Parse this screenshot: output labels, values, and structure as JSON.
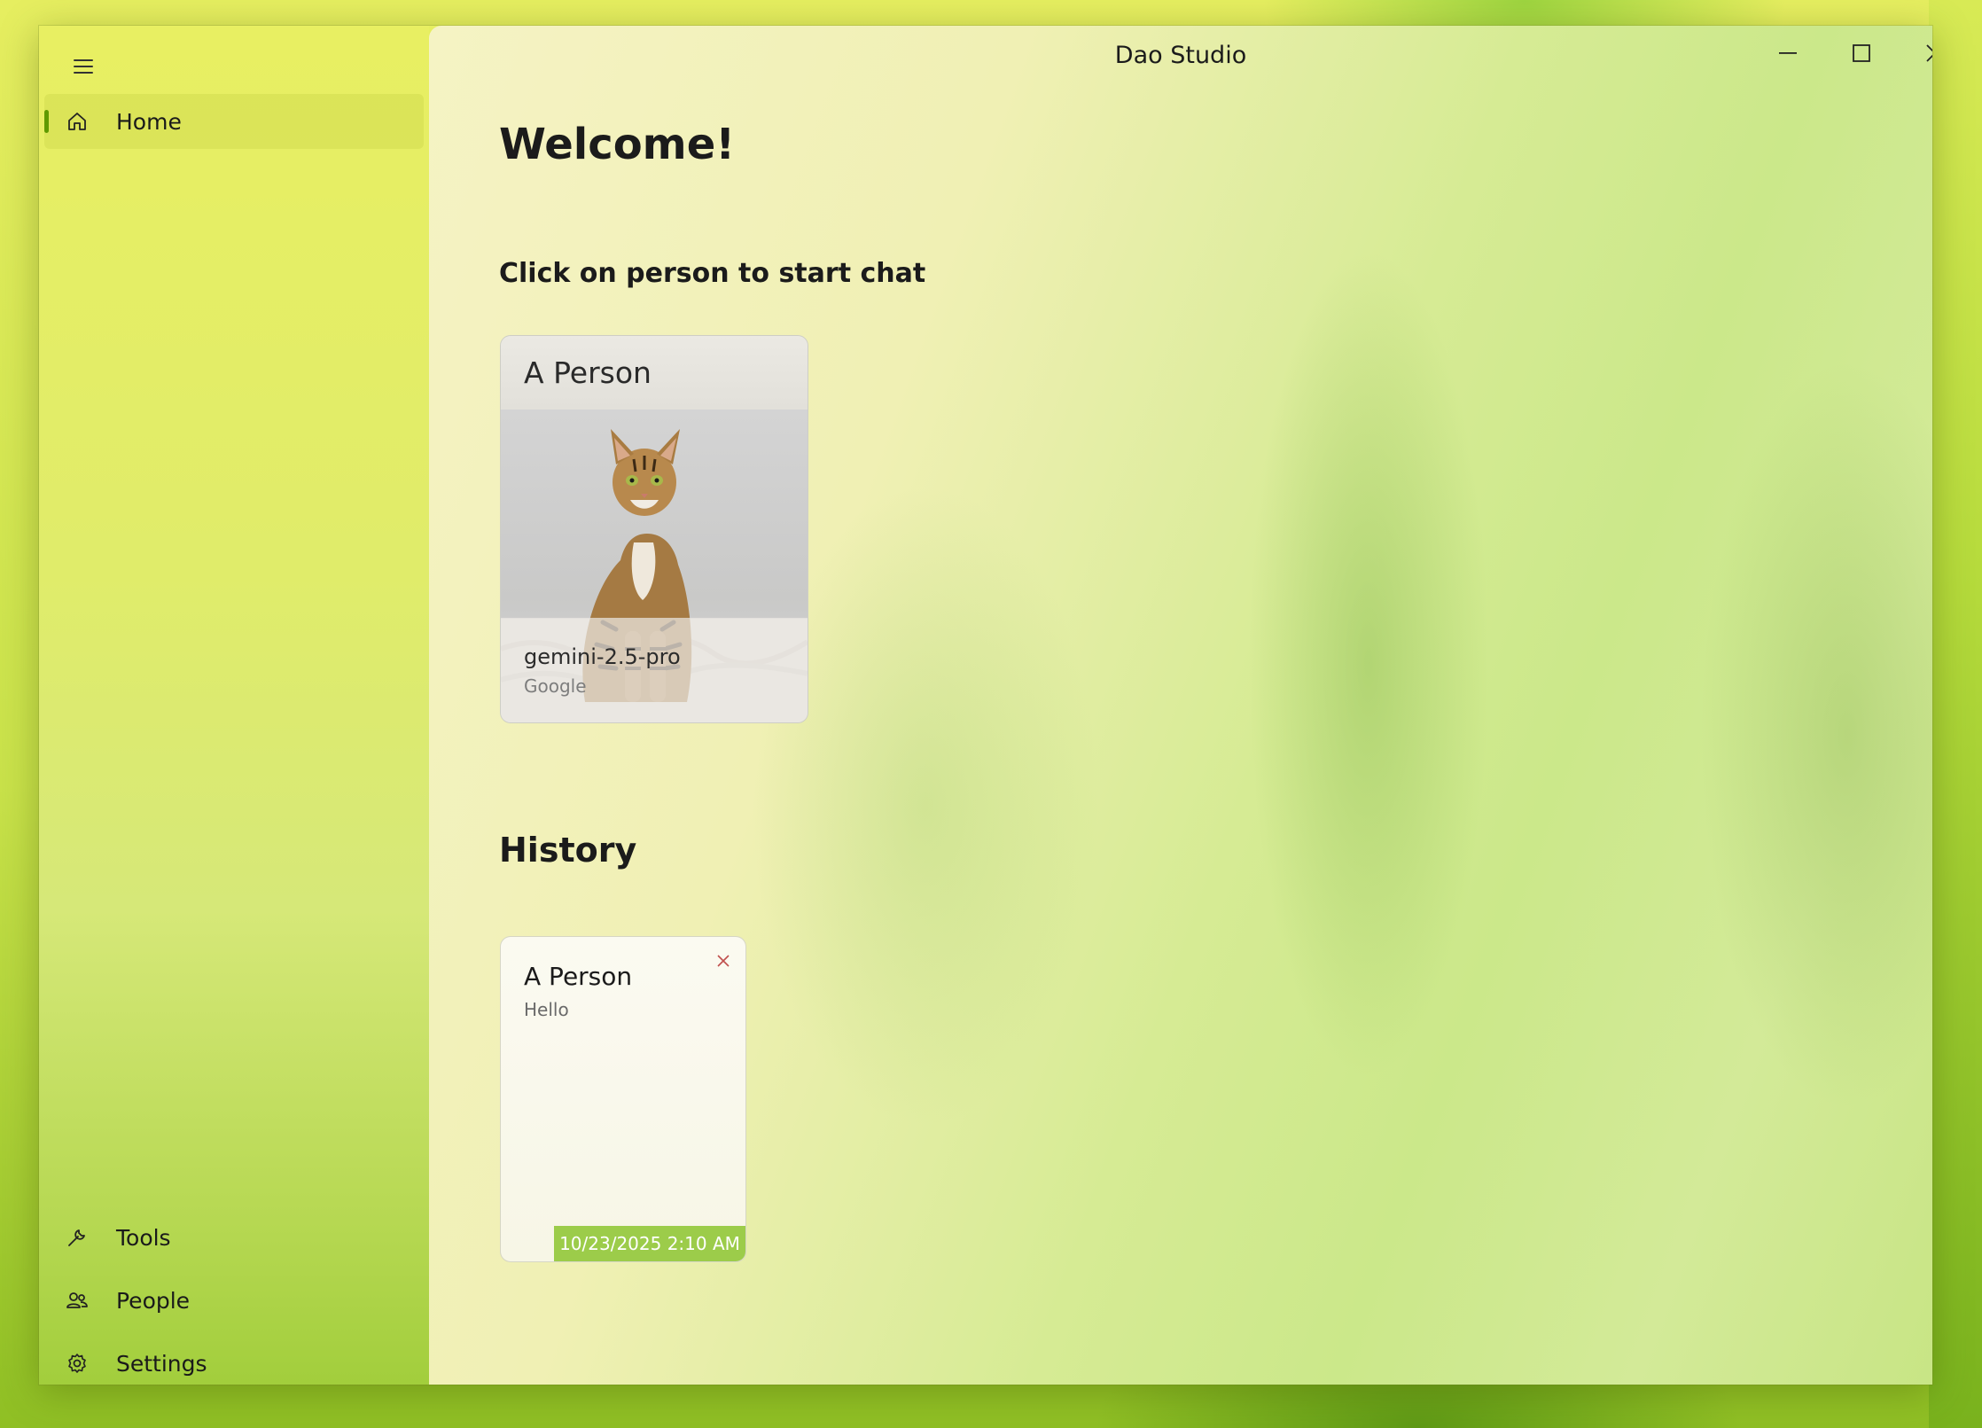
{
  "window": {
    "title": "Dao Studio",
    "controls": {
      "minimize": "minimize-icon",
      "maximize": "maximize-icon",
      "close": "close-icon"
    }
  },
  "sidebar": {
    "menu_icon": "hamburger-menu-icon",
    "top_items": [
      {
        "label": "Home",
        "icon": "home-icon",
        "selected": true
      }
    ],
    "bottom_items": [
      {
        "label": "Tools",
        "icon": "wrench-icon"
      },
      {
        "label": "People",
        "icon": "people-icon"
      },
      {
        "label": "Settings",
        "icon": "gear-icon"
      }
    ]
  },
  "main": {
    "welcome": "Welcome!",
    "start_prompt": "Click on person to start chat",
    "persons": [
      {
        "name": "A Person",
        "model": "gemini-2.5-pro",
        "provider": "Google",
        "image": "cat-photo"
      }
    ],
    "history_heading": "History",
    "history": [
      {
        "title": "A Person",
        "message": "Hello",
        "timestamp": "10/23/2025 2:10 AM"
      }
    ]
  },
  "colors": {
    "accent": "#5f9a00",
    "timestamp_badge": "#9ccc4a",
    "delete_icon": "#c0504d"
  }
}
